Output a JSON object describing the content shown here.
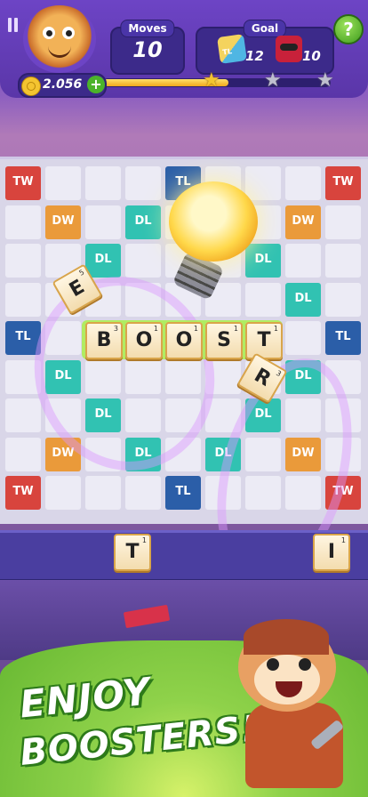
{
  "header": {
    "moves_label": "Moves",
    "moves_value": "10",
    "goal_label": "Goal",
    "goal_items": [
      {
        "icon": "dw-cube-icon",
        "badge": "TL",
        "count": "12"
      },
      {
        "icon": "red-mask-icon",
        "count": "10"
      }
    ],
    "help_label": "?",
    "coins": "2.056",
    "coin_add": "+",
    "stars": [
      "gold",
      "grey",
      "grey"
    ],
    "progress_fraction": 0.55
  },
  "board": {
    "premium_labels": {
      "TW": "TW",
      "DW": "DW",
      "TL": "TL",
      "DL": "DL"
    },
    "word_tiles": [
      {
        "letter": "B",
        "points": "3"
      },
      {
        "letter": "O",
        "points": "1"
      },
      {
        "letter": "O",
        "points": "1"
      },
      {
        "letter": "S",
        "points": "1"
      },
      {
        "letter": "T",
        "points": "1"
      }
    ],
    "flying_tiles": [
      {
        "letter": "E",
        "points": "5"
      },
      {
        "letter": "R",
        "points": "3"
      }
    ]
  },
  "rack": {
    "tiles": [
      {
        "letter": "T",
        "points": "1"
      },
      {
        "letter": "I",
        "points": "1"
      }
    ]
  },
  "promo": {
    "line1": "ENJOY",
    "line2": "BOOSTERS!"
  },
  "colors": {
    "header": "#6d44c5",
    "TW": "#d8443d",
    "DW": "#ea9a3a",
    "TL": "#2b5ea8",
    "DL": "#31c2b2",
    "promo_green": "#8fd24a"
  }
}
